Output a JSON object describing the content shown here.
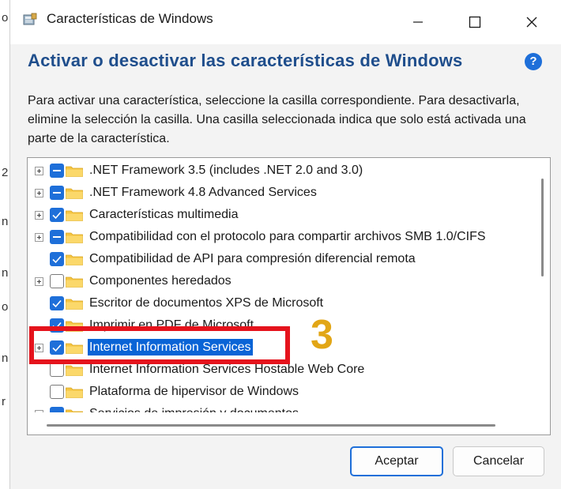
{
  "background": {
    "glyphs": [
      "o",
      "2",
      "n",
      "n",
      "o",
      "n",
      "r"
    ]
  },
  "window": {
    "title": "Características de Windows"
  },
  "heading": "Activar o desactivar las características de Windows",
  "help_label": "?",
  "description": "Para activar una característica, seleccione la casilla correspondiente. Para desactivarla, elimine la selección la casilla. Una casilla seleccionada indica que solo está activada una parte de la característica.",
  "features": [
    {
      "label": ".NET Framework 3.5 (includes .NET 2.0 and 3.0)",
      "state": "partial",
      "expandable": true
    },
    {
      "label": ".NET Framework 4.8 Advanced Services",
      "state": "partial",
      "expandable": true
    },
    {
      "label": "Características multimedia",
      "state": "checked",
      "expandable": true
    },
    {
      "label": "Compatibilidad con el protocolo para compartir archivos SMB 1.0/CIFS",
      "state": "partial",
      "expandable": true
    },
    {
      "label": "Compatibilidad de API para compresión diferencial remota",
      "state": "checked",
      "expandable": false
    },
    {
      "label": "Componentes heredados",
      "state": "unchecked",
      "expandable": true
    },
    {
      "label": "Escritor de documentos XPS de Microsoft",
      "state": "checked",
      "expandable": false
    },
    {
      "label": "Imprimir en PDF de Microsoft",
      "state": "checked",
      "expandable": false
    },
    {
      "label": "Internet Information Services",
      "state": "checked",
      "expandable": true,
      "selected": true
    },
    {
      "label": "Internet Information Services Hostable Web Core",
      "state": "unchecked",
      "expandable": false
    },
    {
      "label": "Plataforma de hipervisor de Windows",
      "state": "unchecked",
      "expandable": false
    },
    {
      "label": "Servicios de impresión y documentos",
      "state": "partial",
      "expandable": true
    }
  ],
  "annotation": {
    "step_number": "3",
    "highlight_color": "#e5131c",
    "number_color": "#e2a616"
  },
  "buttons": {
    "accept": "Aceptar",
    "cancel": "Cancelar"
  },
  "colors": {
    "accent": "#1e6fd9",
    "heading": "#1f4e8c",
    "selection": "#0a64d6",
    "folder": "#f5c542"
  }
}
